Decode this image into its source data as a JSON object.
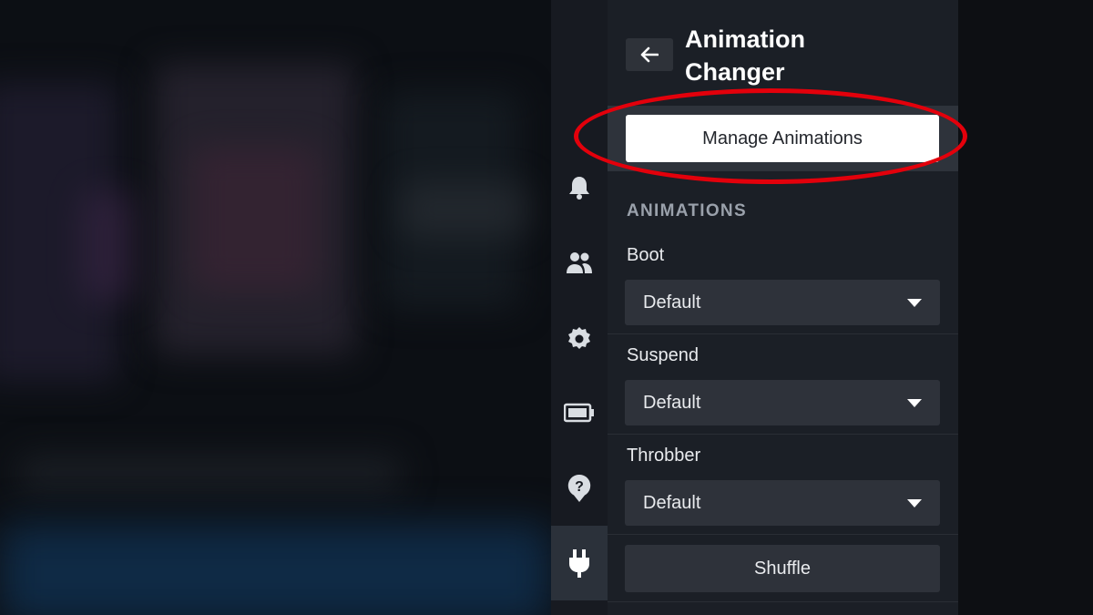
{
  "panel": {
    "title": "Animation\nChanger",
    "manage_button": "Manage Animations",
    "section_header": "ANIMATIONS",
    "fields": [
      {
        "label": "Boot",
        "value": "Default"
      },
      {
        "label": "Suspend",
        "value": "Default"
      },
      {
        "label": "Throbber",
        "value": "Default"
      }
    ],
    "shuffle_button": "Shuffle"
  },
  "rail": {
    "icons": [
      "bell-icon",
      "friends-icon",
      "gear-icon",
      "battery-icon",
      "help-icon",
      "plug-icon"
    ],
    "active": "plug-icon"
  },
  "colors": {
    "highlight": "#e3000b",
    "panel_bg": "#1b1f26",
    "rail_bg": "#171a21"
  }
}
